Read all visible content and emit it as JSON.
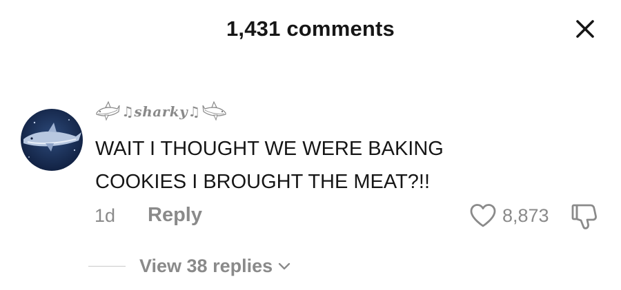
{
  "header": {
    "title": "1,431 comments"
  },
  "comment": {
    "username": "♫sharky♫",
    "text": "WAIT I THOUGHT WE WERE BAKING\nCOOKIES I BROUGHT THE MEAT?!!",
    "time": "1d",
    "reply_label": "Reply",
    "like_count": "8,873",
    "view_replies_label": "View 38 replies"
  },
  "icons": {
    "close": "close-icon",
    "avatar": "shark-avatar",
    "like": "heart-icon",
    "dislike": "thumbs-down-icon",
    "expand": "chevron-down-icon",
    "username_decoration": "shark-emoji-icon"
  },
  "colors": {
    "primary_text": "#161616",
    "secondary_text": "#8a8a8a",
    "background": "#ffffff"
  }
}
